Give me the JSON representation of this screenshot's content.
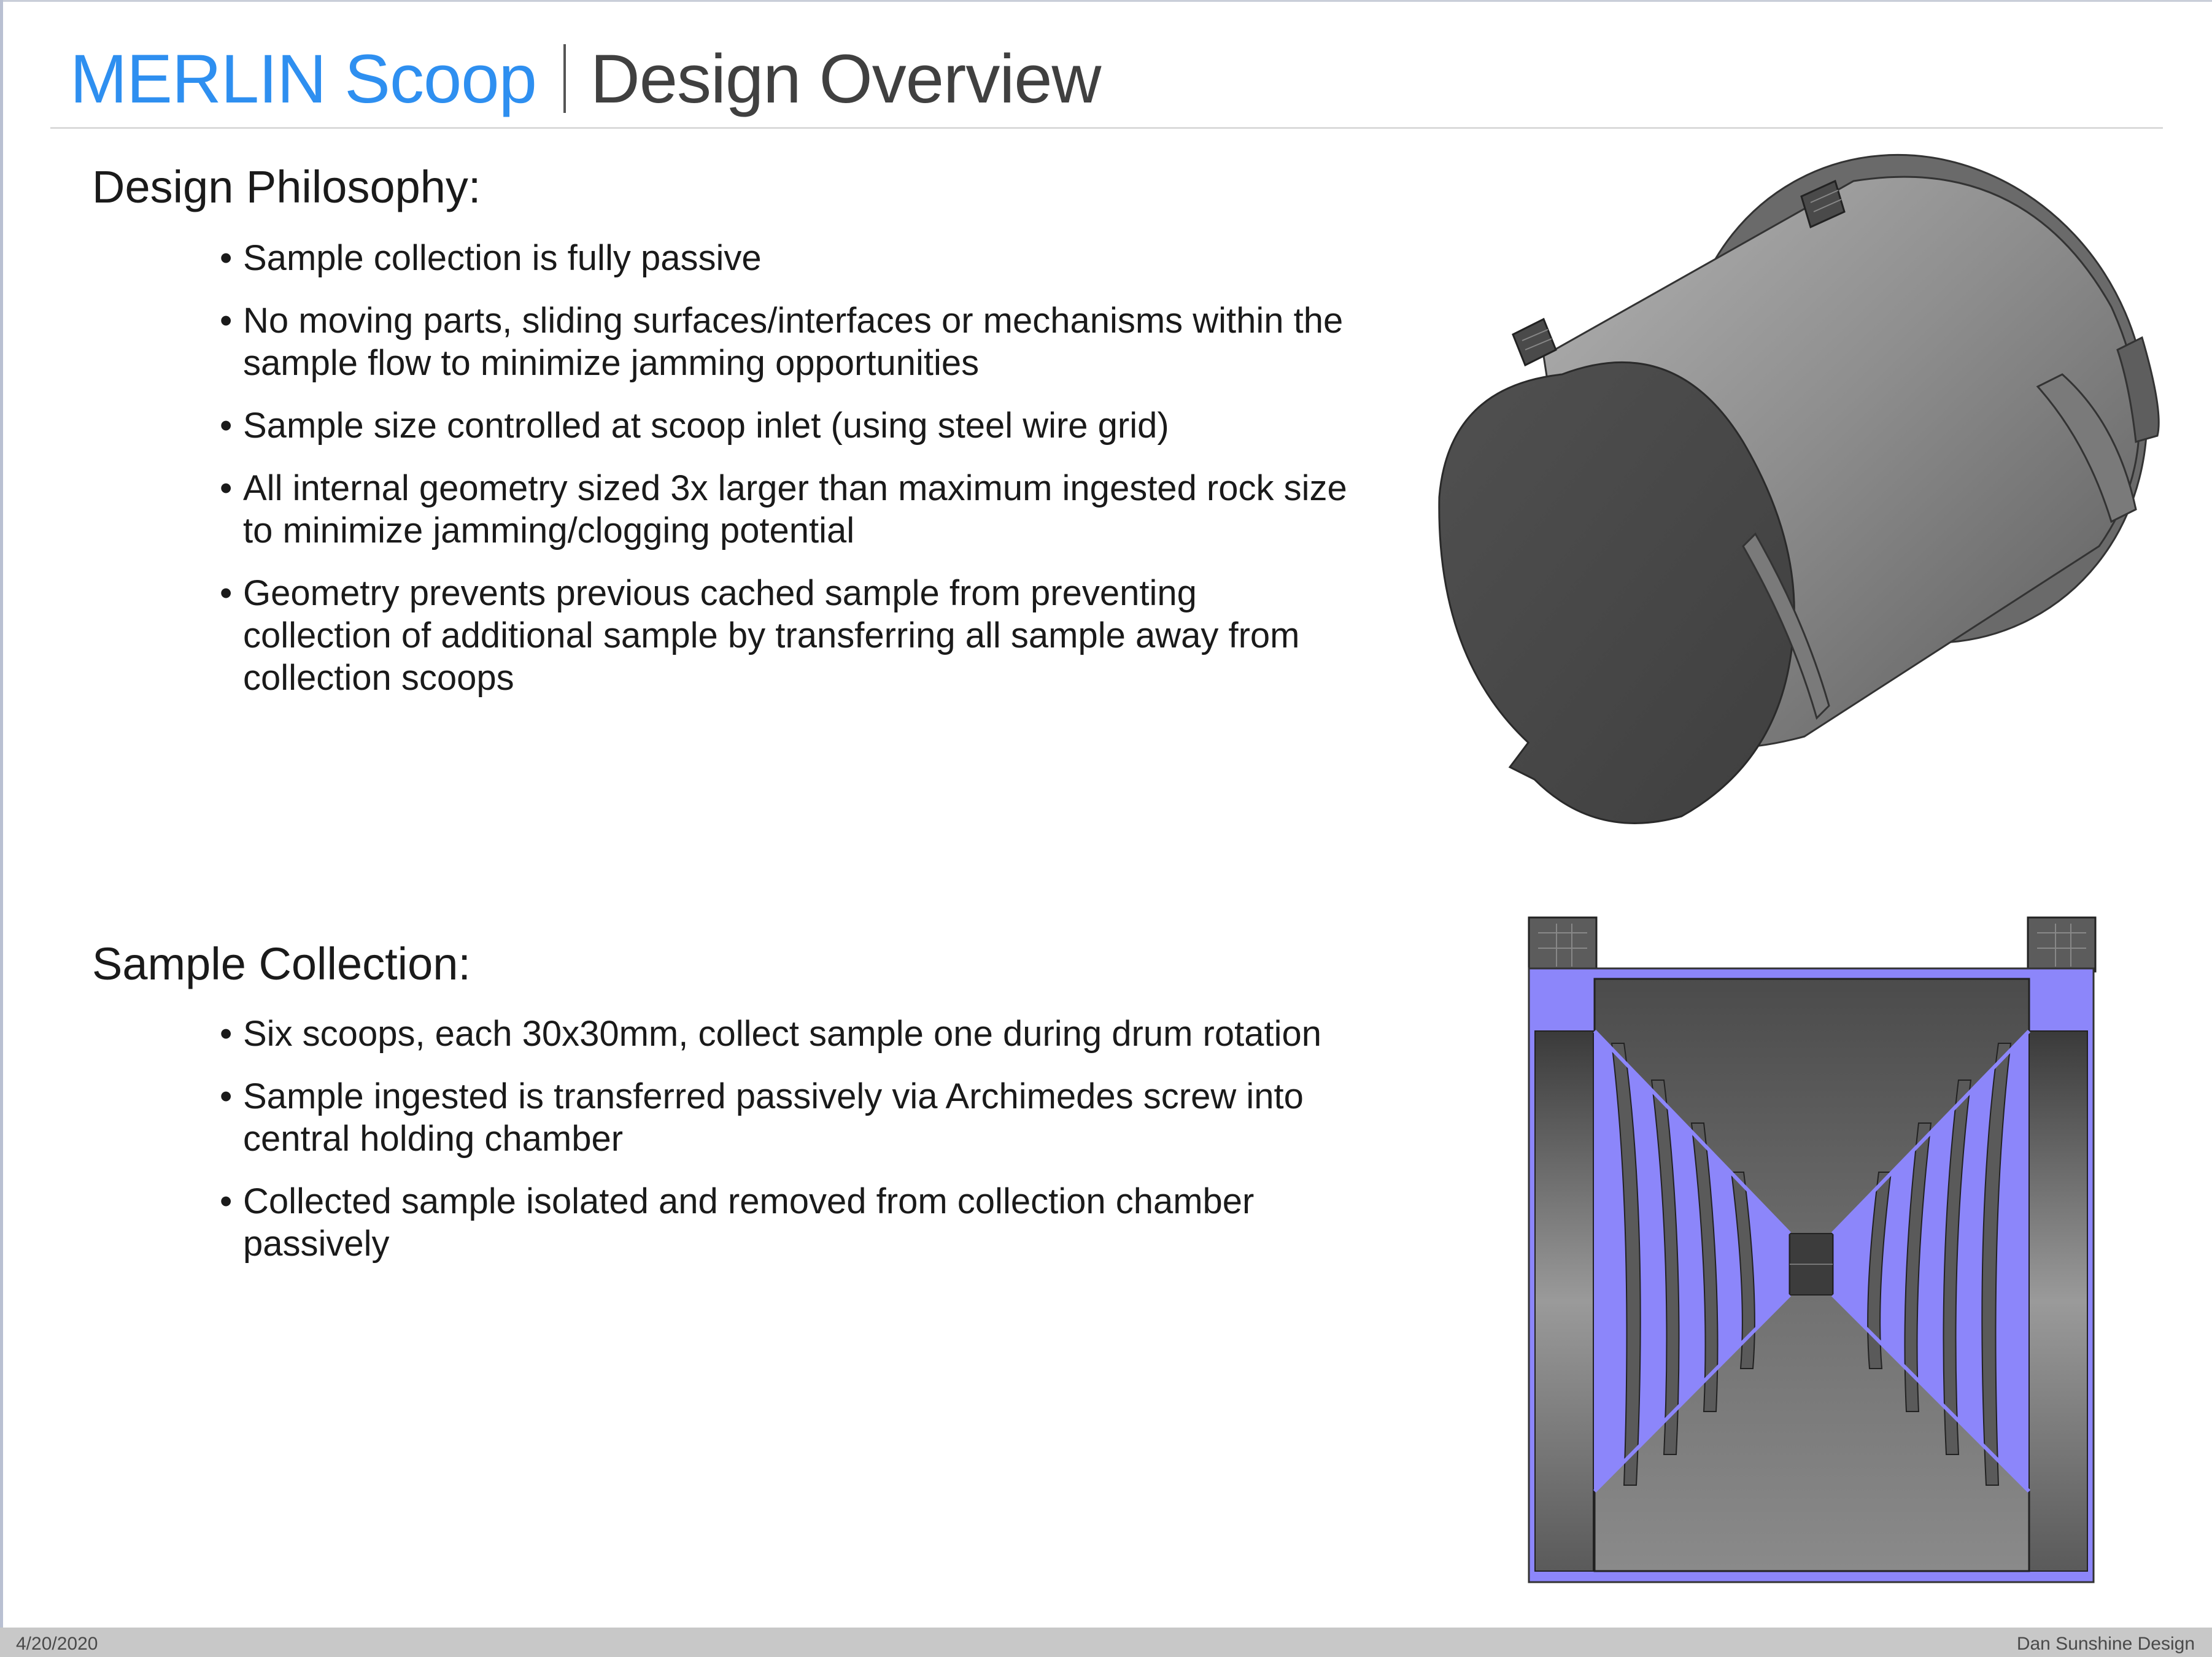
{
  "title": {
    "main": "MERLIN Scoop",
    "sub": "Design Overview"
  },
  "sections": [
    {
      "heading": "Design Philosophy:",
      "bullets": [
        "Sample collection is fully passive",
        "No moving parts, sliding surfaces/interfaces or mechanisms within the sample flow to minimize jamming opportunities",
        "Sample size controlled at scoop inlet (using steel wire grid)",
        "All internal geometry sized 3x larger than maximum ingested rock size to minimize jamming/clogging potential",
        "Geometry prevents previous cached sample from preventing collection of additional sample by transferring all sample away from collection scoops"
      ]
    },
    {
      "heading": "Sample Collection:",
      "bullets": [
        "Six scoops, each 30x30mm, collect sample one during drum rotation",
        "Sample ingested is transferred passively via Archimedes screw into central holding chamber",
        "Collected sample isolated and removed from collection chamber passively"
      ]
    }
  ],
  "bullet_glyph": "•",
  "footer": {
    "date": "4/20/2020",
    "author": "Dan Sunshine Design"
  },
  "colors": {
    "title_accent": "#2e8ff0",
    "section_highlight": "#8c86fa",
    "render_gray": "#6f6f6f"
  }
}
